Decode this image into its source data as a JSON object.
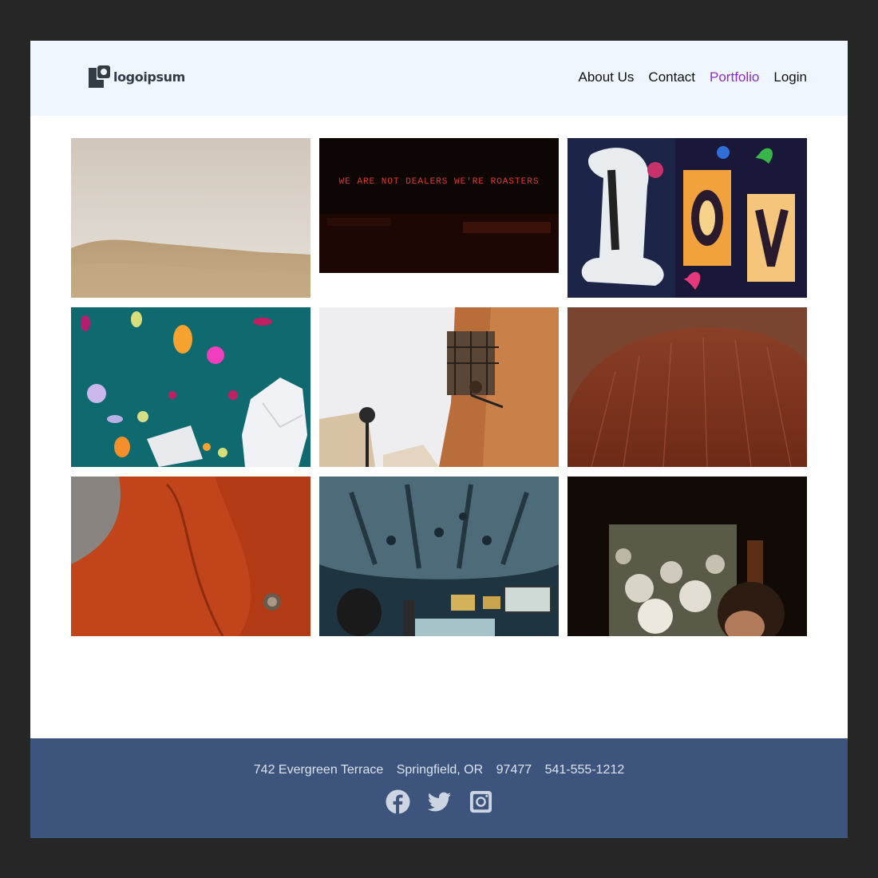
{
  "brand": {
    "name": "logoipsum"
  },
  "nav": {
    "items": [
      {
        "label": "About Us",
        "active": false
      },
      {
        "label": "Contact",
        "active": false
      },
      {
        "label": "Portfolio",
        "active": true
      },
      {
        "label": "Login",
        "active": false
      }
    ]
  },
  "gallery": {
    "photos": [
      {
        "subject": "desert-dunes"
      },
      {
        "subject": "neon-sign",
        "sign_text": "WE ARE NOT DEALERS WE'RE ROASTERS"
      },
      {
        "subject": "painted-window-love"
      },
      {
        "subject": "confetti-paper-head"
      },
      {
        "subject": "brick-building-balcony"
      },
      {
        "subject": "auburn-hair"
      },
      {
        "subject": "orange-jacket"
      },
      {
        "subject": "bus-interior"
      },
      {
        "subject": "flowers-window"
      }
    ]
  },
  "footer": {
    "street": "742 Evergreen Terrace",
    "city": "Springfield, OR",
    "zip": "97477",
    "phone": "541-555-1212",
    "social": [
      "facebook-icon",
      "twitter-icon",
      "instagram-icon"
    ]
  },
  "colors": {
    "header_bg": "#eff6ff",
    "footer_bg": "#3d547c",
    "nav_active": "#8b2fc9",
    "footer_text": "#dbe3ef"
  }
}
